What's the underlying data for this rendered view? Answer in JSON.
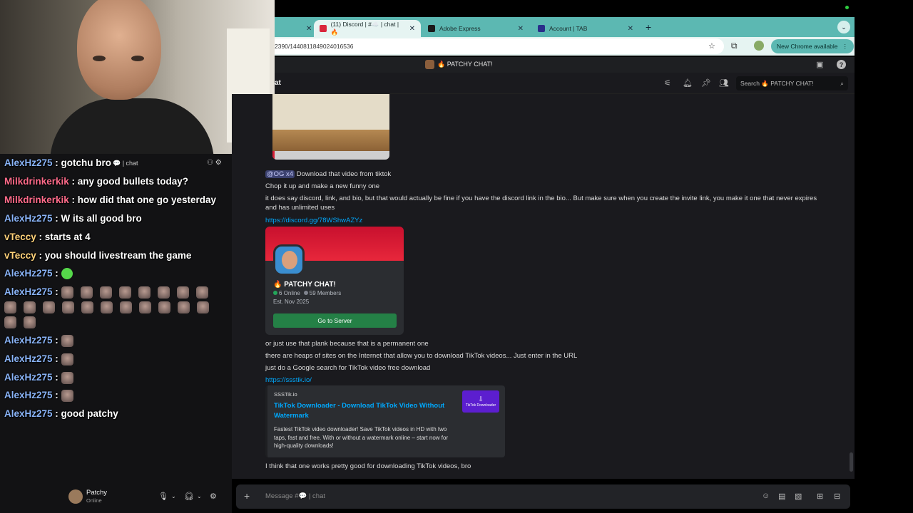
{
  "browser": {
    "tabs": [
      {
        "label": "(11) Discord | #☁️ | chat | 🔥",
        "active": true,
        "color": "#d9263c"
      },
      {
        "label": "Adobe Express",
        "active": false,
        "color": "#1a1a1a"
      },
      {
        "label": "Account | TAB",
        "active": false,
        "color": "#2a2f8a"
      }
    ],
    "url": "2390/1440811849024016536",
    "new_chrome_label": "New Chrome available"
  },
  "discord": {
    "server_title": "🔥 PATCHY CHAT!",
    "channel_name": "at",
    "search_placeholder": "Search 🔥 PATCHY CHAT!",
    "messages": {
      "m1_mention": "@OG x4",
      "m1_text": " Download that video from tiktok",
      "m2": "Chop it up and make a new funny one",
      "m3": "it does say discord, link, and bio, but that would actually be fine if you have the discord link in the bio... But make sure when you create the invite link, you make it one that never expires and has unlimited uses",
      "m4_link": "https://discord.gg/78WShwAZYz",
      "m5": "or just use that plank because that is a permanent one",
      "m6": "there are heaps of sites on the Internet that allow you to download TikTok videos... Just enter in the URL",
      "m7": "just do a Google search for TikTok video free download",
      "m8_link": "https://ssstik.io/",
      "m9": "I think that one works pretty good for downloading TikTok videos, bro"
    },
    "invite": {
      "name": "🔥 PATCHY CHAT!",
      "online": "6 Online",
      "members": "59 Members",
      "est": "Est. Nov 2025",
      "button": "Go to Server"
    },
    "embed": {
      "provider": "SSSTik.io",
      "title": "TikTok Downloader - Download TikTok Video Without Watermark",
      "description": "Fastest TikTok video downloader! Save TikTok videos in HD with two taps, fast and free. With or without a watermark online – start now for high-quality downloads!",
      "thumb_label": "TikTok Downloader"
    },
    "composer_placeholder": "Message #💬 | chat",
    "user": {
      "name": "Patchy",
      "status": "Online"
    },
    "overlay_channel": "💬 | chat"
  },
  "stream_chat": {
    "lines": [
      {
        "user": "AlexHz275",
        "text": " : gotchu bro"
      },
      {
        "user": "Milkdrinkerkik",
        "text": " : any good bullets today?"
      },
      {
        "user": "Milkdrinkerkik",
        "text": " : how did that one go yesterday"
      },
      {
        "user": "AlexHz275",
        "text": " : W its all good bro"
      },
      {
        "user": "vTeccy",
        "text": " : starts at 4"
      },
      {
        "user": "vTeccy",
        "text": " : you should livestream the game"
      },
      {
        "user": "AlexHz275",
        "text": " : "
      },
      {
        "user": "AlexHz275",
        "text": " : "
      },
      {
        "user": "AlexHz275",
        "text": " : "
      },
      {
        "user": "AlexHz275",
        "text": " : "
      },
      {
        "user": "AlexHz275",
        "text": " : "
      },
      {
        "user": "AlexHz275",
        "text": " : "
      },
      {
        "user": "AlexHz275",
        "text": " : good patchy"
      }
    ]
  }
}
